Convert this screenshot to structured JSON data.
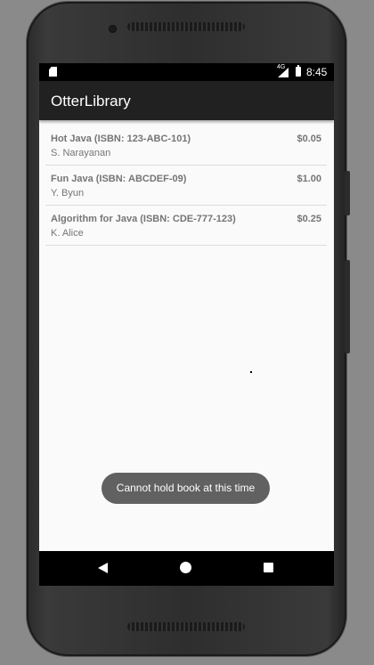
{
  "status_bar": {
    "network": "4G",
    "time": "8:45"
  },
  "app_bar": {
    "title": "OtterLibrary"
  },
  "books": [
    {
      "title": "Hot Java (ISBN: 123-ABC-101)",
      "author": "S. Narayanan",
      "price": "$0.05"
    },
    {
      "title": "Fun Java (ISBN: ABCDEF-09)",
      "author": "Y. Byun",
      "price": "$1.00"
    },
    {
      "title": "Algorithm for Java (ISBN: CDE-777-123)",
      "author": "K. Alice",
      "price": "$0.25"
    }
  ],
  "toast": {
    "message": "Cannot hold book at this time"
  },
  "icons": {
    "status": [
      "sd-card-icon",
      "signal-icon",
      "battery-icon"
    ],
    "navigation": [
      "back-icon",
      "home-icon",
      "recents-icon"
    ]
  },
  "colors": {
    "app_bar": "#212121",
    "screen_background": "#fafafa",
    "toast_background": "#616161",
    "list_text": "#757575"
  }
}
